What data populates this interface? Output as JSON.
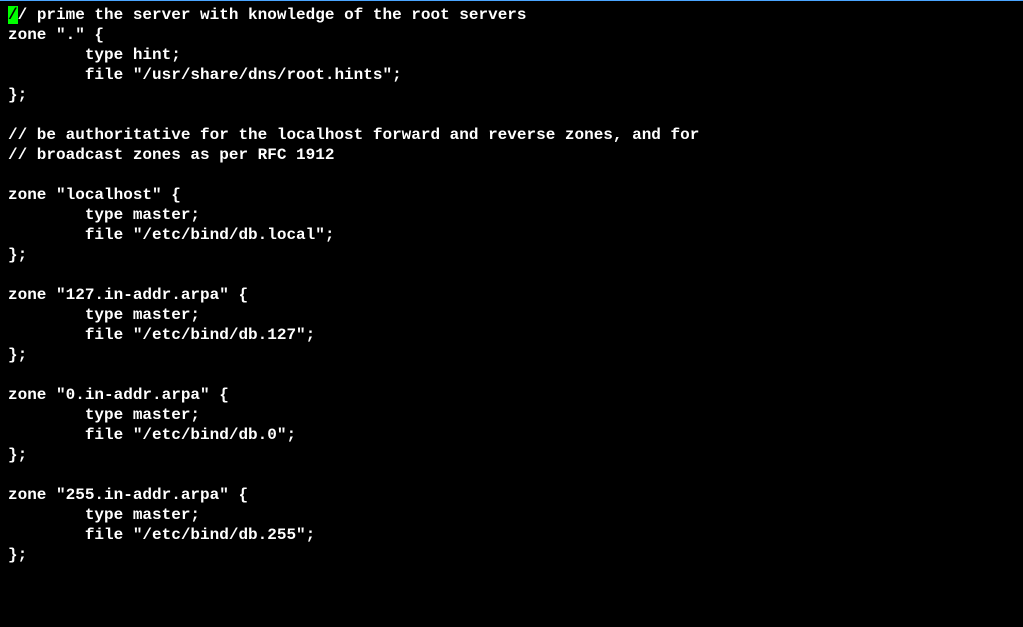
{
  "terminal": {
    "cursor_char": "/",
    "lines": [
      "/ prime the server with knowledge of the root servers",
      "zone \".\" {",
      "        type hint;",
      "        file \"/usr/share/dns/root.hints\";",
      "};",
      "",
      "// be authoritative for the localhost forward and reverse zones, and for",
      "// broadcast zones as per RFC 1912",
      "",
      "zone \"localhost\" {",
      "        type master;",
      "        file \"/etc/bind/db.local\";",
      "};",
      "",
      "zone \"127.in-addr.arpa\" {",
      "        type master;",
      "        file \"/etc/bind/db.127\";",
      "};",
      "",
      "zone \"0.in-addr.arpa\" {",
      "        type master;",
      "        file \"/etc/bind/db.0\";",
      "};",
      "",
      "zone \"255.in-addr.arpa\" {",
      "        type master;",
      "        file \"/etc/bind/db.255\";",
      "};"
    ]
  }
}
